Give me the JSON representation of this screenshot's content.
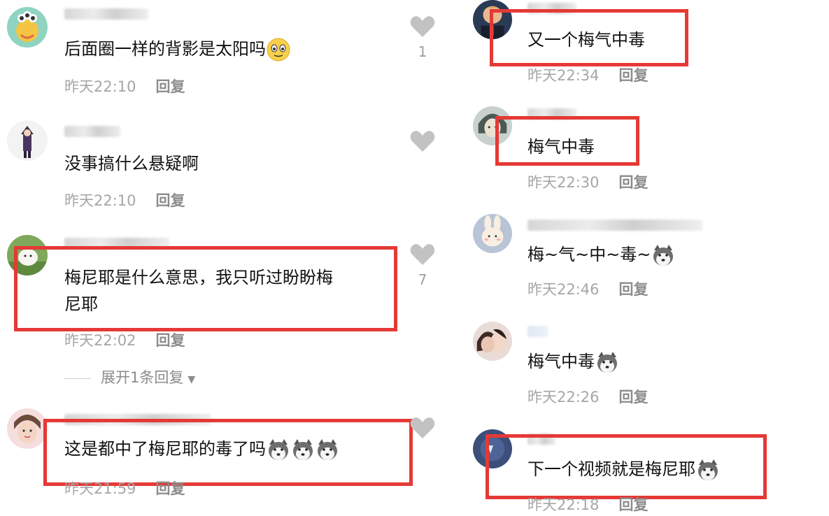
{
  "left_column": [
    {
      "text": "后面圈一样的背影是太阳吗",
      "emoji": "blush-emoji",
      "time": "昨天22:10",
      "reply": "回复",
      "likes": "1"
    },
    {
      "text": "没事搞什么悬疑啊",
      "time": "昨天22:10",
      "reply": "回复",
      "likes": ""
    },
    {
      "text_line1": "梅尼耶是什么意思，我只听过盼盼梅",
      "text_line2": "尼耶",
      "time": "昨天22:02",
      "reply": "回复",
      "likes": "7",
      "expand": "展开1条回复"
    },
    {
      "text": "这是都中了梅尼耶的毒了吗",
      "emoji": "husky-emoji",
      "time": "昨天21:59",
      "reply": "回复",
      "likes": ""
    }
  ],
  "right_column": [
    {
      "text": "又一个梅气中毒",
      "time": "昨天22:34",
      "reply": "回复"
    },
    {
      "text": "梅气中毒",
      "time": "昨天22:30",
      "reply": "回复"
    },
    {
      "text": "梅~气~中~毒~",
      "emoji": "husky-emoji",
      "time": "昨天22:46",
      "reply": "回复"
    },
    {
      "text": "梅气中毒",
      "emoji": "husky-emoji",
      "time": "昨天22:26",
      "reply": "回复"
    },
    {
      "text": "下一个视频就是梅尼耶",
      "emoji": "husky-emoji",
      "time": "昨天22:18",
      "reply": "回复"
    }
  ],
  "colors": {
    "highlight": "#e53935",
    "time": "#a6a6a6",
    "reply": "#8c8c8c",
    "like": "#b0b0b0"
  }
}
